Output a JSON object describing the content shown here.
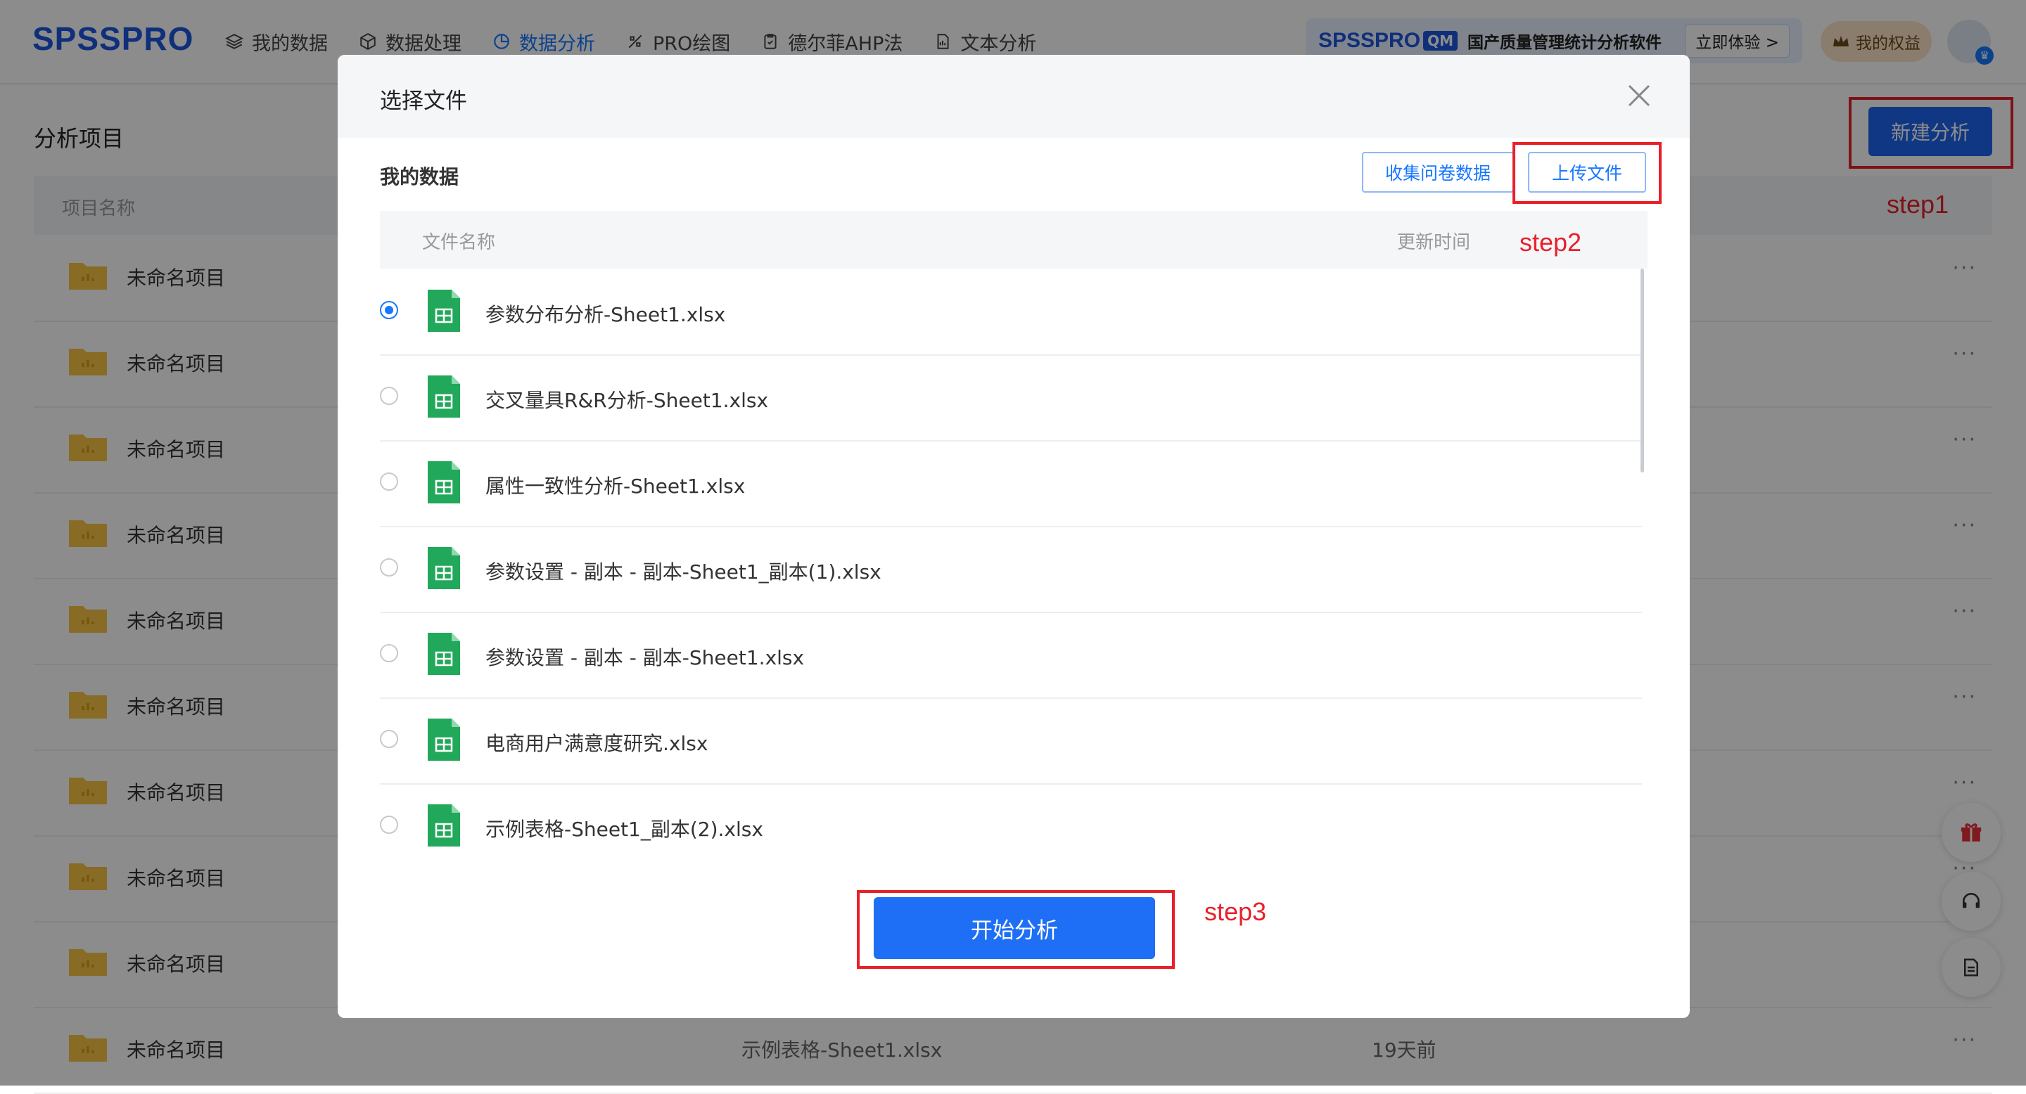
{
  "app": {
    "logo": "SPSSPRO",
    "nav": [
      {
        "label": "我的数据",
        "icon": "layers-icon",
        "active": false
      },
      {
        "label": "数据处理",
        "icon": "cube-icon",
        "active": false
      },
      {
        "label": "数据分析",
        "icon": "pie-icon",
        "active": true
      },
      {
        "label": "PRO绘图",
        "icon": "paint-icon",
        "active": false
      },
      {
        "label": "德尔菲AHP法",
        "icon": "clipboard-icon",
        "active": false
      },
      {
        "label": "文本分析",
        "icon": "doc-chart-icon",
        "active": false
      }
    ],
    "promo": {
      "brand": "SPSSPRO",
      "qm": "QM",
      "text": "国产质量管理统计分析软件",
      "button": "立即体验 >"
    },
    "rights": "我的权益",
    "colors": {
      "accent": "#1677ff",
      "primary_button": "#1e6ff5",
      "annotation": "#e8202a"
    }
  },
  "projects": {
    "title": "分析项目",
    "new_button": "新建分析",
    "column_name": "项目名称",
    "rows": [
      {
        "name": "未命名项目",
        "file": "",
        "time": ""
      },
      {
        "name": "未命名项目",
        "file": "",
        "time": ""
      },
      {
        "name": "未命名项目",
        "file": "",
        "time": ""
      },
      {
        "name": "未命名项目",
        "file": "",
        "time": ""
      },
      {
        "name": "未命名项目",
        "file": "",
        "time": ""
      },
      {
        "name": "未命名项目",
        "file": "",
        "time": ""
      },
      {
        "name": "未命名项目",
        "file": "",
        "time": ""
      },
      {
        "name": "未命名项目",
        "file": "",
        "time": ""
      },
      {
        "name": "未命名项目",
        "file": "",
        "time": ""
      },
      {
        "name": "未命名项目",
        "file": "示例表格-Sheet1.xlsx",
        "time": "19天前"
      }
    ],
    "more": "···"
  },
  "modal": {
    "title": "选择文件",
    "section": "我的数据",
    "collect_button": "收集问卷数据",
    "upload_button": "上传文件",
    "col_name": "文件名称",
    "col_time": "更新时间",
    "files": [
      {
        "name": "参数分布分析-Sheet1.xlsx",
        "selected": true
      },
      {
        "name": "交叉量具R&R分析-Sheet1.xlsx",
        "selected": false
      },
      {
        "name": "属性一致性分析-Sheet1.xlsx",
        "selected": false
      },
      {
        "name": "参数设置 - 副本 - 副本-Sheet1_副本(1).xlsx",
        "selected": false
      },
      {
        "name": "参数设置 - 副本 - 副本-Sheet1.xlsx",
        "selected": false
      },
      {
        "name": "电商用户满意度研究.xlsx",
        "selected": false
      },
      {
        "name": "示例表格-Sheet1_副本(2).xlsx",
        "selected": false
      }
    ],
    "start_button": "开始分析"
  },
  "annotations": {
    "step1": "step1",
    "step2": "step2",
    "step3": "step3"
  }
}
